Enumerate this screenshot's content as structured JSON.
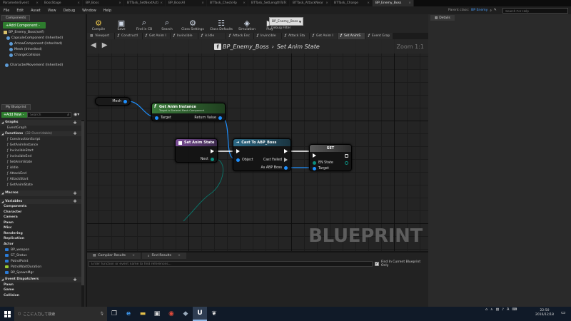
{
  "doc_tabs": [
    "ParameterEvent",
    "BossStage",
    "BP_Boss",
    "BTTask_SetNextActi",
    "BP_BossAI",
    "BTTask_CheckHp",
    "BTTask_SetLengthToT",
    "BTTask_AttackNear",
    "BTTask_Charge",
    "BP_Enemy_Boss"
  ],
  "menu": [
    "File",
    "Edit",
    "Asset",
    "View",
    "Debug",
    "Window",
    "Help"
  ],
  "toolbar": [
    {
      "label": "Compile",
      "icon": "compile-icon"
    },
    {
      "label": "Save",
      "icon": "save-icon"
    },
    {
      "label": "Find in CB",
      "icon": "find-in-cb-icon"
    },
    {
      "label": "Search",
      "icon": "search-icon"
    },
    {
      "label": "Class Settings",
      "icon": "class-settings-icon"
    },
    {
      "label": "Class Defaults",
      "icon": "class-defaults-icon"
    },
    {
      "label": "Simulation",
      "icon": "simulation-icon"
    },
    {
      "label": "Play",
      "icon": "play-icon"
    }
  ],
  "debug_filter": {
    "value": "BP_Enemy_Boss",
    "label": "Debug Filter"
  },
  "left_panel": {
    "components_tab": "Components",
    "add_component": "+Add Component -",
    "components": [
      "BP_Enemy_Boss(self)",
      "CapsuleComponent (Inherited)",
      "ArrowComponent (Inherited)",
      "Mesh (Inherited)",
      "ChargeCollision",
      "CharacterMovement (Inherited)"
    ],
    "my_blueprint_tab": "My Blueprint",
    "add_new": "+Add New -",
    "search_placeholder": "Search",
    "graphs_header": "Graphs",
    "graphs": [
      "EventGraph"
    ],
    "functions_header": "Functions",
    "functions_count": "(32 Overridable)",
    "functions": [
      "ConstructionScript",
      "GetAnimInstance",
      "InvincibleStart",
      "invincibleEnd",
      "SetAnimState",
      "isIdle",
      "AttackEnd",
      "AttackStart",
      "GetAnimState"
    ],
    "macros_header": "Macros",
    "variables_header": "Variables",
    "var_groups": [
      "Components",
      "Character",
      "Camera",
      "Pawn",
      "Misc",
      "Rendering",
      "Replication",
      "Actor"
    ],
    "variables": [
      {
        "name": "BP_weapon",
        "color": "#2b7bd6"
      },
      {
        "name": "ST_Status",
        "color": "#2b7bd6"
      },
      {
        "name": "PatrolPoint",
        "color": "#2b7bd6"
      },
      {
        "name": "PatrolWaitDuration",
        "color": "#9acd32"
      },
      {
        "name": "BP_SpawnMgr",
        "color": "#2b7bd6"
      }
    ],
    "event_dispatchers_header": "Event Dispatchers",
    "dispatcher_groups": [
      "Pawn",
      "Game",
      "Collision"
    ]
  },
  "graph_tabs": [
    "Viewport",
    "ConstructI",
    "Get Anim I",
    "Invincible",
    "is Idle",
    "Attack Enc",
    "Invincible",
    "Attack Sta",
    "Get Anim I",
    "Set AnimS",
    "Event Grap"
  ],
  "graph_tabs_active": 9,
  "breadcrumb": {
    "blueprint": "BP_Enemy_Boss",
    "separator": "›",
    "function": "Set Anim State"
  },
  "zoom": "Zoom 1:1",
  "watermark": "BLUEPRINT",
  "nodes": {
    "mesh": {
      "title": "Mesh"
    },
    "get_anim_instance": {
      "title": "Get Anim Instance",
      "subtitle": "Target is Skeletal Mesh Component",
      "pin_target": "Target",
      "pin_return": "Return Value"
    },
    "set_anim_state": {
      "title": "Set Anim State",
      "pin_next": "Next"
    },
    "cast": {
      "title": "Cast To ABP_Boss",
      "pin_object": "Object",
      "pin_failed": "Cast Failed",
      "pin_as": "As ABP Boss"
    },
    "set": {
      "title": "SET",
      "pin_en_state": "EN State",
      "pin_target": "Target"
    }
  },
  "bottom_panel": {
    "tabs": [
      "Compiler Results",
      "Find Results"
    ],
    "find_placeholder": "Enter function or event name to find references...",
    "find_current": "Find In Current Blueprint Only"
  },
  "right_panel": {
    "parent_class_label": "Parent class:",
    "parent_class_value": "BP Enemy",
    "help_placeholder": "Search For Help",
    "details_tab": "Details"
  },
  "taskbar": {
    "search_placeholder": "ここに入力して検索",
    "apps": [
      "task-view-icon",
      "edge-icon",
      "explorer-icon",
      "store-icon",
      "chrome-icon",
      "app-icon",
      "unreal-icon",
      "app2-icon"
    ],
    "ime": "A",
    "time": "22:50",
    "date": "2016/12/18"
  },
  "colors": {
    "pin_blue": "#1e90ff",
    "pure_node_header": "#2f6b2f",
    "function_header": "#6a4c82",
    "cast_header": "#2a5b73",
    "set_header": "#505050"
  }
}
